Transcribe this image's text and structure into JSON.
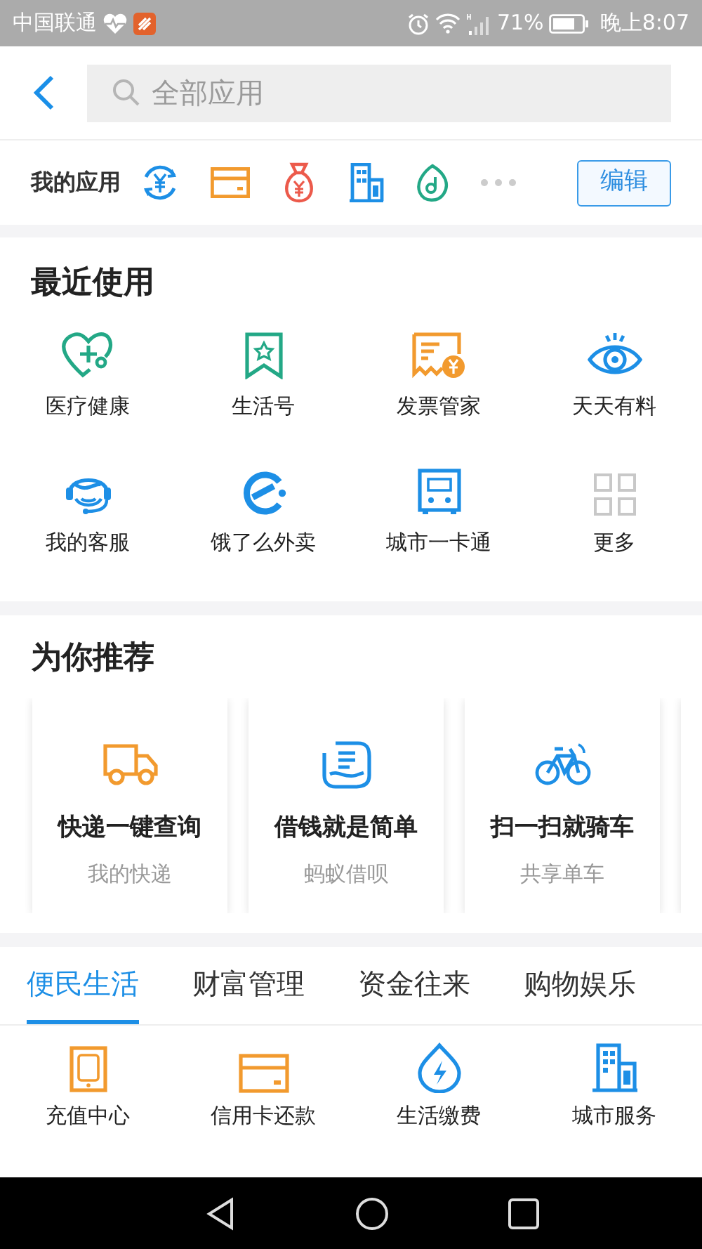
{
  "status_bar": {
    "carrier": "中国联通",
    "battery": "71%",
    "time": "晚上8:07"
  },
  "header": {
    "search": {
      "placeholder": "全部应用"
    }
  },
  "my_apps": {
    "label": "我的应用",
    "edit_button": "编辑"
  },
  "recent": {
    "title": "最近使用",
    "items": [
      {
        "label": "医疗健康"
      },
      {
        "label": "生活号"
      },
      {
        "label": "发票管家"
      },
      {
        "label": "天天有料"
      },
      {
        "label": "我的客服"
      },
      {
        "label": "饿了么外卖"
      },
      {
        "label": "城市一卡通"
      },
      {
        "label": "更多"
      }
    ]
  },
  "recommend": {
    "title": "为你推荐",
    "cards": [
      {
        "title": "快递一键查询",
        "subtitle": "我的快递"
      },
      {
        "title": "借钱就是简单",
        "subtitle": "蚂蚁借呗"
      },
      {
        "title": "扫一扫就骑车",
        "subtitle": "共享单车"
      }
    ]
  },
  "categories": {
    "tabs": [
      {
        "label": "便民生活",
        "selected": true
      },
      {
        "label": "财富管理",
        "selected": false
      },
      {
        "label": "资金往来",
        "selected": false
      },
      {
        "label": "购物娱乐",
        "selected": false
      }
    ],
    "items": [
      {
        "label": "充值中心"
      },
      {
        "label": "信用卡还款"
      },
      {
        "label": "生活缴费"
      },
      {
        "label": "城市服务"
      }
    ]
  }
}
